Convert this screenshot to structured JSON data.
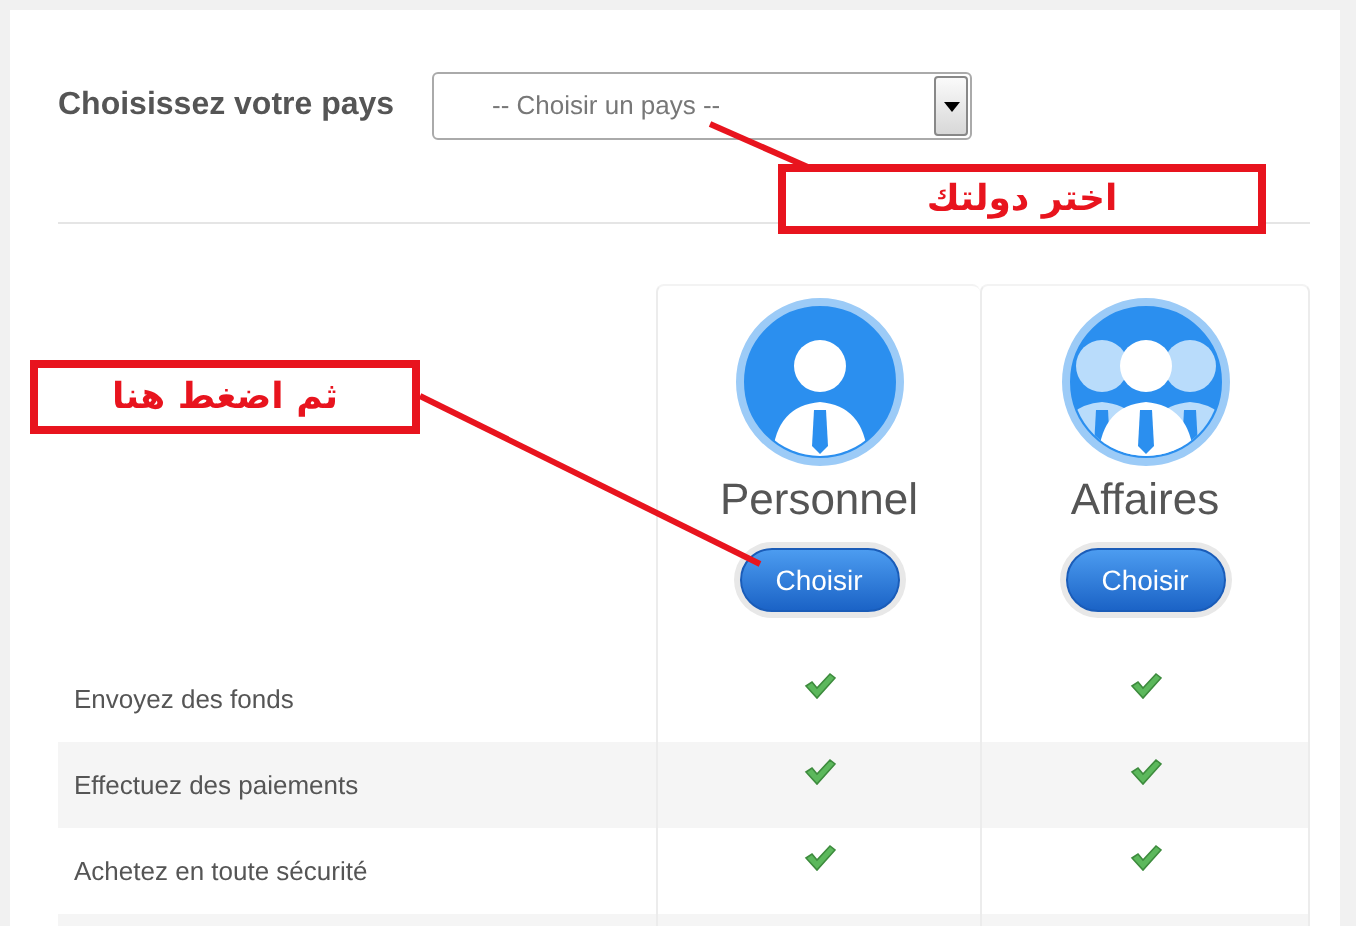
{
  "country": {
    "label": "Choisissez votre pays",
    "select": {
      "placeholder": "-- Choisir un pays --"
    }
  },
  "plans": [
    {
      "kind": "single",
      "title": "Personnel",
      "button": "Choisir"
    },
    {
      "kind": "group",
      "title": "Affaires",
      "button": "Choisir"
    }
  ],
  "features": [
    {
      "label": "Envoyez des fonds",
      "included": [
        true,
        true
      ]
    },
    {
      "label": "Effectuez des paiements",
      "included": [
        true,
        true
      ]
    },
    {
      "label": "Achetez en toute sécurité",
      "included": [
        true,
        true
      ]
    }
  ],
  "annotations": [
    {
      "text": "اختر دولتك"
    },
    {
      "text": "ثم اضغط هنا"
    }
  ]
}
